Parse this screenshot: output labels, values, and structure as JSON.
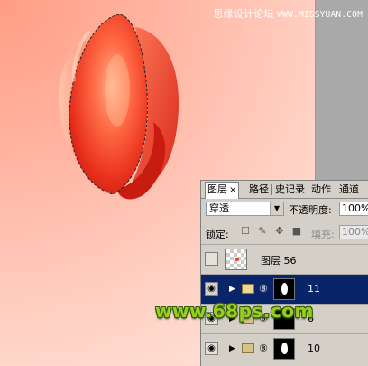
{
  "watermark": {
    "cn": "思缘设计论坛",
    "url": "WWW.MISSYUAN.COM"
  },
  "logo_text": "www.68ps.com",
  "layers_panel": {
    "tabs": [
      {
        "label": "图层",
        "active": true,
        "close": "×"
      },
      {
        "label": "路径",
        "active": false
      },
      {
        "label": "史记录",
        "active": false
      },
      {
        "label": "动作",
        "active": false
      },
      {
        "label": "通道",
        "active": false
      }
    ],
    "blend_mode": "穿透",
    "opacity_label": "不透明度:",
    "opacity_value": "100%",
    "lock_label": "锁定:",
    "lock_icons": "☐ ✎ ✥ ■",
    "fill_label": "填充:",
    "fill_value": "100%",
    "layers": [
      {
        "name": "图层 56",
        "type": "layer",
        "selected": false,
        "visible": false,
        "eye": ""
      },
      {
        "name": "11",
        "type": "group",
        "selected": true,
        "visible": true,
        "eye": "◉",
        "expander": "▶",
        "link": "⑧"
      },
      {
        "name": "6",
        "type": "group",
        "selected": false,
        "visible": true,
        "eye": "◉",
        "expander": "▶",
        "link": "⑧"
      },
      {
        "name": "10",
        "type": "group",
        "selected": false,
        "visible": true,
        "eye": "◉",
        "expander": "▶",
        "link": "⑧"
      }
    ]
  },
  "colors": {
    "selected_row": "#0a246a",
    "panel_bg": "#d4d0c8",
    "canvas_bg": "#ffd3c6",
    "tulip": "#e8402a"
  }
}
